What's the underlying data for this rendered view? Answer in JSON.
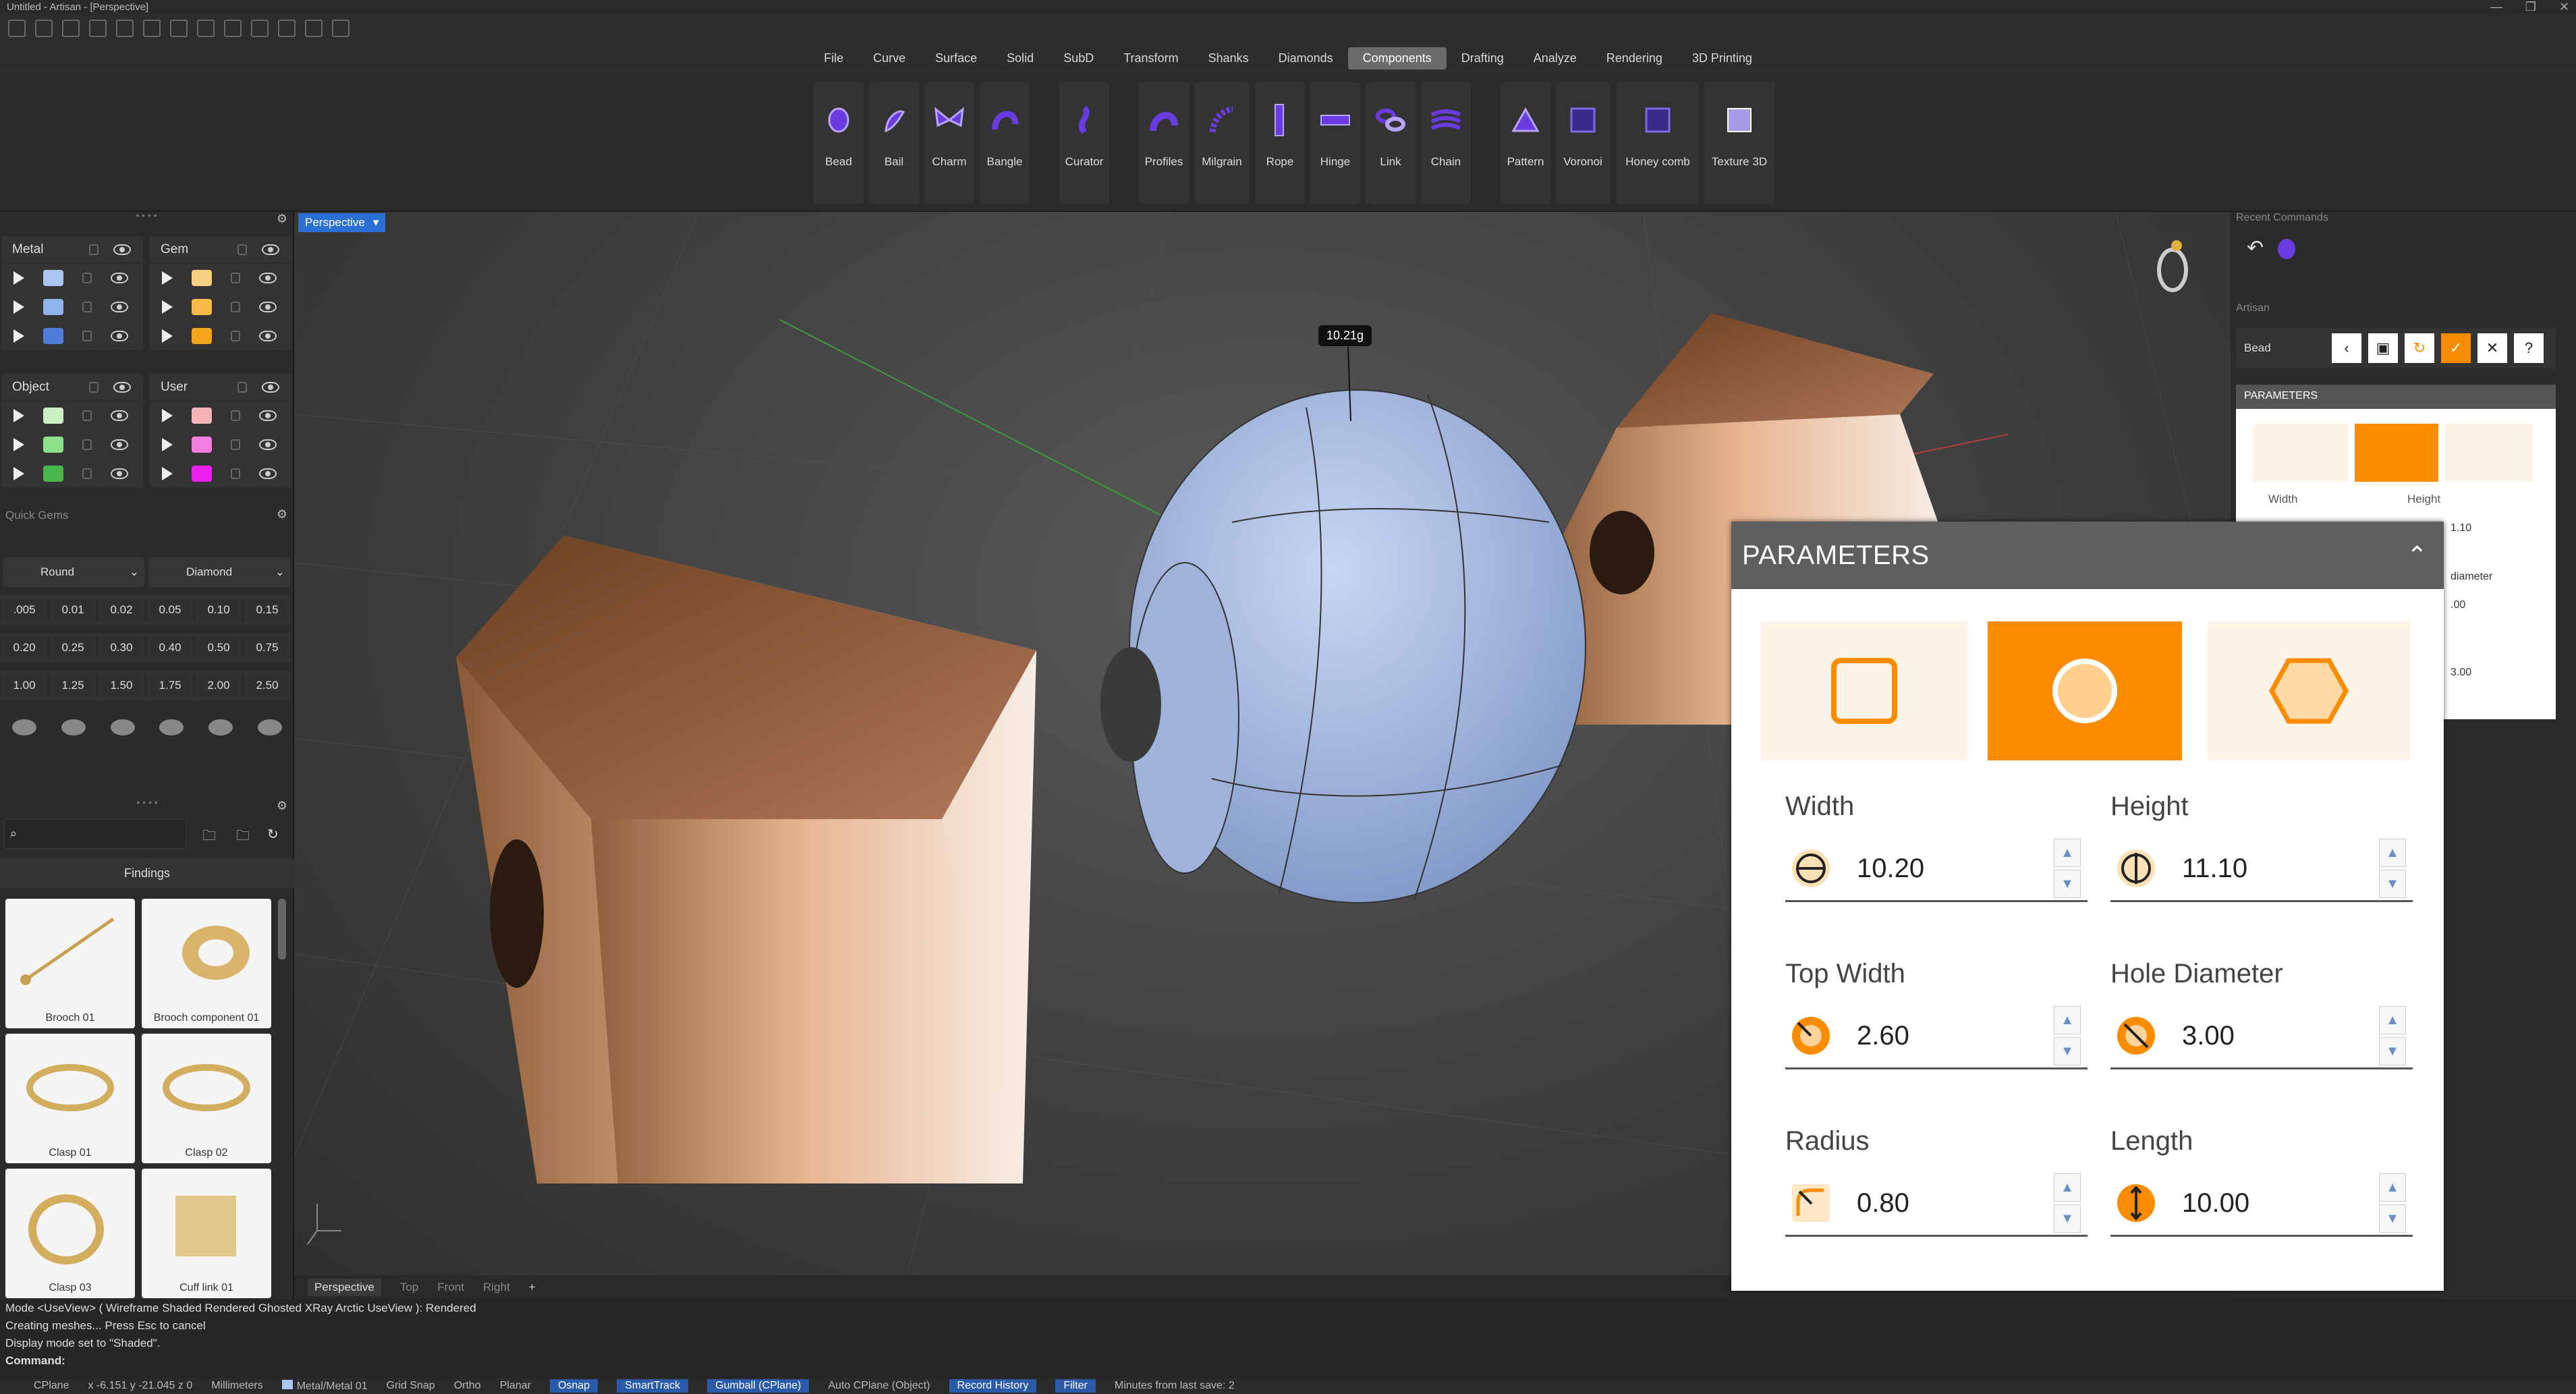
{
  "window": {
    "title": "Untitled - Artisan - [Perspective]"
  },
  "menu": {
    "items": [
      "File",
      "Curve",
      "Surface",
      "Solid",
      "SubD",
      "Transform",
      "Shanks",
      "Diamonds",
      "Components",
      "Drafting",
      "Analyze",
      "Rendering",
      "3D Printing"
    ],
    "active": "Components"
  },
  "ribbon": {
    "tools": [
      "Bead",
      "Bail",
      "Charm",
      "Bangle",
      "Curator",
      "Profiles",
      "Milgrain",
      "Rope",
      "Hinge",
      "Link",
      "Chain",
      "Pattern",
      "Voronoi",
      "Honey comb",
      "Texture 3D"
    ]
  },
  "layers": {
    "groups": [
      {
        "name": "Metal",
        "colors": [
          "#a9c5f2",
          "#8fb4ee",
          "#4f7ed8"
        ]
      },
      {
        "name": "Gem",
        "colors": [
          "#f7cf82",
          "#f6bb48",
          "#f4a418"
        ]
      },
      {
        "name": "Object",
        "colors": [
          "#c9efc3",
          "#8ee088",
          "#48b84a"
        ]
      },
      {
        "name": "User",
        "colors": [
          "#f4b4b8",
          "#f27ee0",
          "#ec20ec"
        ]
      }
    ]
  },
  "quick_gems": {
    "title": "Quick Gems",
    "shape": "Round",
    "material": "Diamond",
    "sizes": [
      ".005",
      "0.01",
      "0.02",
      "0.05",
      "0.10",
      "0.15",
      "0.20",
      "0.25",
      "0.30",
      "0.40",
      "0.50",
      "0.75",
      "1.00",
      "1.25",
      "1.50",
      "1.75",
      "2.00",
      "2.50"
    ]
  },
  "library": {
    "category": "Findings",
    "items": [
      "Brooch 01",
      "Brooch component 01",
      "Clasp 01",
      "Clasp 02",
      "Clasp 03",
      "Cuff link 01"
    ]
  },
  "viewport": {
    "name": "Perspective",
    "weight_label": "10.21g",
    "tabs": [
      "Perspective",
      "Top",
      "Front",
      "Right"
    ]
  },
  "right_panel": {
    "recent_title": "Recent Commands",
    "artisan_title": "Artisan",
    "command": "Bead",
    "params_title": "PARAMETERS",
    "mini_labels": [
      "Width",
      "Height"
    ],
    "mini_values": [
      "1.10",
      "diameter",
      ".00",
      "3.00"
    ]
  },
  "parameters": {
    "title": "PARAMETERS",
    "shapes": [
      "square",
      "circle",
      "hexagon"
    ],
    "selected_shape": "circle",
    "fields": [
      {
        "label": "Width",
        "value": "10.20"
      },
      {
        "label": "Height",
        "value": "11.10"
      },
      {
        "label": "Top Width",
        "value": "2.60"
      },
      {
        "label": "Hole Diameter",
        "value": "3.00"
      },
      {
        "label": "Radius",
        "value": "0.80"
      },
      {
        "label": "Length",
        "value": "10.00"
      }
    ]
  },
  "command_history": [
    "Mode <UseView> ( Wireframe  Shaded  Rendered  Ghosted  XRay  Arctic  UseView ): Rendered",
    "Creating meshes... Press Esc to cancel",
    "Display mode set to \"Shaded\".",
    "Command:"
  ],
  "status": {
    "cplane": "CPlane",
    "coords": "x -6.151   y -21.045   z 0",
    "units": "Millimeters",
    "layer": "Metal/Metal 01",
    "toggles": [
      "Grid Snap",
      "Ortho",
      "Planar"
    ],
    "active_toggles": [
      "Osnap",
      "SmartTrack",
      "Gumball (CPlane)"
    ],
    "auto_cplane": "Auto CPlane (Object)",
    "record": "Record History",
    "filter": "Filter",
    "save": "Minutes from last save: 2"
  },
  "colors": {
    "accent": "#fb8c00",
    "viewport_label": "#2a6fd6",
    "metal": "#c98a5c",
    "bead": "#a9bde0"
  }
}
